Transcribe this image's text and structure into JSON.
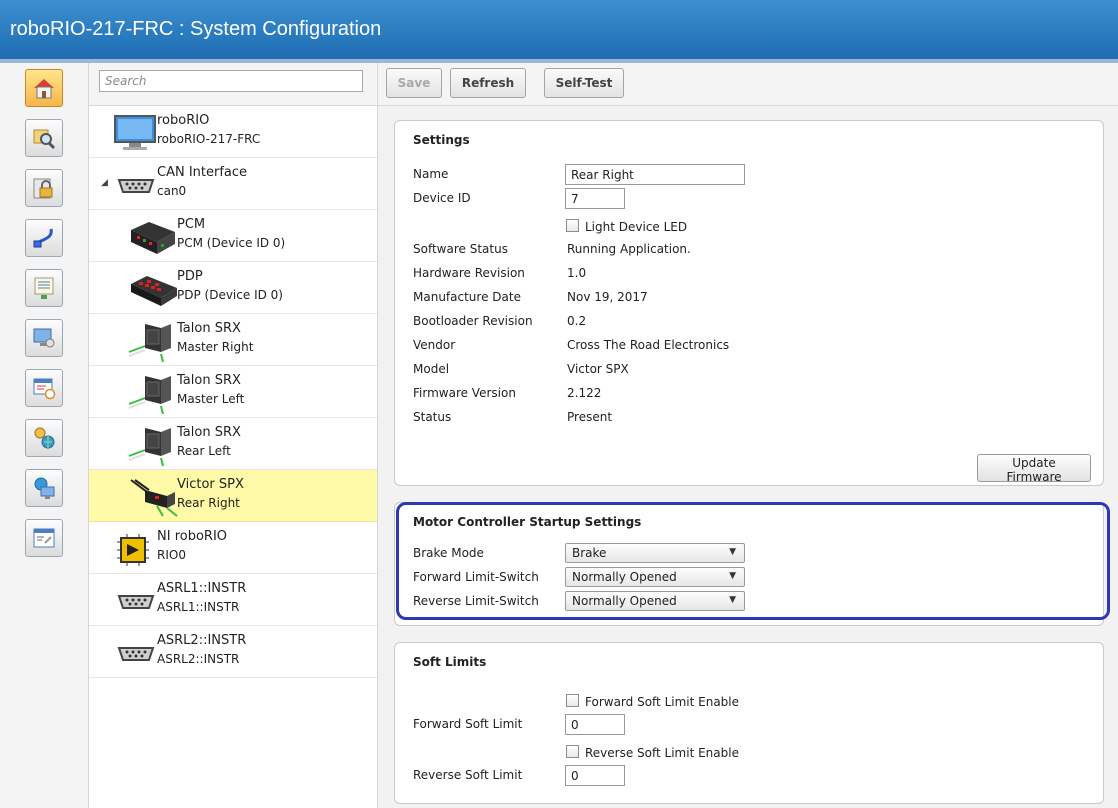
{
  "window": {
    "title": "roboRIO-217-FRC : System Configuration"
  },
  "nav": {
    "icons": [
      "home-icon",
      "search-icon",
      "lock-icon",
      "network-icon",
      "list-icon",
      "monitor-icon",
      "schedule-icon",
      "network-settings-icon",
      "remote-desktop-icon",
      "console-icon"
    ]
  },
  "search": {
    "placeholder": "Search"
  },
  "tree": {
    "items": [
      {
        "name": "roboRIO",
        "sub": "roboRIO-217-FRC"
      },
      {
        "name": "CAN Interface",
        "sub": "can0"
      },
      {
        "name": "PCM",
        "sub": "PCM (Device ID 0)"
      },
      {
        "name": "PDP",
        "sub": "PDP (Device ID 0)"
      },
      {
        "name": "Talon SRX",
        "sub": "Master Right"
      },
      {
        "name": "Talon SRX",
        "sub": "Master Left"
      },
      {
        "name": "Talon SRX",
        "sub": "Rear Left"
      },
      {
        "name": "Victor SPX",
        "sub": "Rear Right"
      },
      {
        "name": "NI roboRIO",
        "sub": "RIO0"
      },
      {
        "name": "ASRL1::INSTR",
        "sub": "ASRL1::INSTR"
      },
      {
        "name": "ASRL2::INSTR",
        "sub": "ASRL2::INSTR"
      }
    ]
  },
  "toolbar": {
    "save": "Save",
    "refresh": "Refresh",
    "selftest": "Self-Test"
  },
  "settings": {
    "header": "Settings",
    "name_label": "Name",
    "name_value": "Rear Right",
    "deviceid_label": "Device ID",
    "deviceid_value": "7",
    "led_label": "Light Device LED",
    "rows": [
      {
        "label": "Software Status",
        "value": "Running Application."
      },
      {
        "label": "Hardware Revision",
        "value": "1.0"
      },
      {
        "label": "Manufacture Date",
        "value": "Nov 19, 2017"
      },
      {
        "label": "Bootloader Revision",
        "value": "0.2"
      },
      {
        "label": "Vendor",
        "value": "Cross The Road Electronics"
      },
      {
        "label": "Model",
        "value": "Victor SPX"
      },
      {
        "label": "Firmware Version",
        "value": "2.122"
      },
      {
        "label": "Status",
        "value": "Present"
      }
    ],
    "update_button": "Update Firmware"
  },
  "startup": {
    "header": "Motor Controller Startup Settings",
    "rows": [
      {
        "label": "Brake Mode",
        "value": "Brake"
      },
      {
        "label": "Forward Limit-Switch",
        "value": "Normally Opened"
      },
      {
        "label": "Reverse Limit-Switch",
        "value": "Normally Opened"
      }
    ]
  },
  "soft": {
    "header": "Soft Limits",
    "fwd_enable": "Forward Soft Limit Enable",
    "fwd_label": "Forward Soft Limit",
    "fwd_value": "0",
    "rev_enable": "Reverse Soft Limit Enable",
    "rev_label": "Reverse Soft Limit",
    "rev_value": "0"
  },
  "colors": {
    "title_bar": "#2a7cc3",
    "selection": "#fffaa8",
    "annotation": "#2f37b5"
  }
}
